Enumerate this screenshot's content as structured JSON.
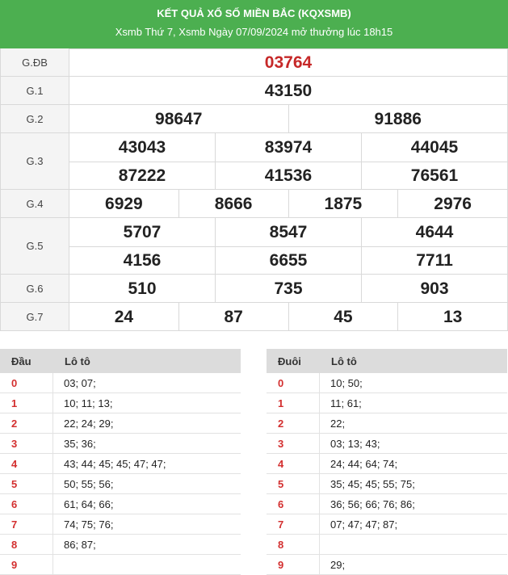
{
  "header": {
    "title": "KẾT QUẢ XỔ SỐ MIỀN BẮC (KQXSMB)",
    "subtitle": "Xsmb Thứ 7, Xsmb Ngày 07/09/2024 mở thưởng lúc 18h15"
  },
  "prizes": [
    {
      "label": "G.ĐB",
      "rows": [
        [
          "03764"
        ]
      ]
    },
    {
      "label": "G.1",
      "rows": [
        [
          "43150"
        ]
      ]
    },
    {
      "label": "G.2",
      "rows": [
        [
          "98647",
          "91886"
        ]
      ]
    },
    {
      "label": "G.3",
      "rows": [
        [
          "43043",
          "83974",
          "44045"
        ],
        [
          "87222",
          "41536",
          "76561"
        ]
      ]
    },
    {
      "label": "G.4",
      "rows": [
        [
          "6929",
          "8666",
          "1875",
          "2976"
        ]
      ]
    },
    {
      "label": "G.5",
      "rows": [
        [
          "5707",
          "8547",
          "4644"
        ],
        [
          "4156",
          "6655",
          "7711"
        ]
      ]
    },
    {
      "label": "G.6",
      "rows": [
        [
          "510",
          "735",
          "903"
        ]
      ]
    },
    {
      "label": "G.7",
      "rows": [
        [
          "24",
          "87",
          "45",
          "13"
        ]
      ]
    }
  ],
  "loto_head": {
    "col1": "Đầu",
    "col2": "Lô tô",
    "rows": [
      {
        "k": "0",
        "v": "03; 07;"
      },
      {
        "k": "1",
        "v": "10; 11; 13;"
      },
      {
        "k": "2",
        "v": "22; 24; 29;"
      },
      {
        "k": "3",
        "v": "35; 36;"
      },
      {
        "k": "4",
        "v": "43; 44; 45; 45; 47; 47;"
      },
      {
        "k": "5",
        "v": "50; 55; 56;"
      },
      {
        "k": "6",
        "v": "61; 64; 66;"
      },
      {
        "k": "7",
        "v": "74; 75; 76;"
      },
      {
        "k": "8",
        "v": "86; 87;"
      },
      {
        "k": "9",
        "v": ""
      }
    ]
  },
  "loto_tail": {
    "col1": "Đuôi",
    "col2": "Lô tô",
    "rows": [
      {
        "k": "0",
        "v": "10; 50;"
      },
      {
        "k": "1",
        "v": "11; 61;"
      },
      {
        "k": "2",
        "v": "22;"
      },
      {
        "k": "3",
        "v": "03; 13; 43;"
      },
      {
        "k": "4",
        "v": "24; 44; 64; 74;"
      },
      {
        "k": "5",
        "v": "35; 45; 45; 55; 75;"
      },
      {
        "k": "6",
        "v": "36; 56; 66; 76; 86;"
      },
      {
        "k": "7",
        "v": "07; 47; 47; 87;"
      },
      {
        "k": "8",
        "v": ""
      },
      {
        "k": "9",
        "v": "29;"
      }
    ]
  },
  "colors": {
    "header_bg": "#4caf50",
    "special_prize": "#c62828",
    "loto_key": "#d32f2f"
  }
}
